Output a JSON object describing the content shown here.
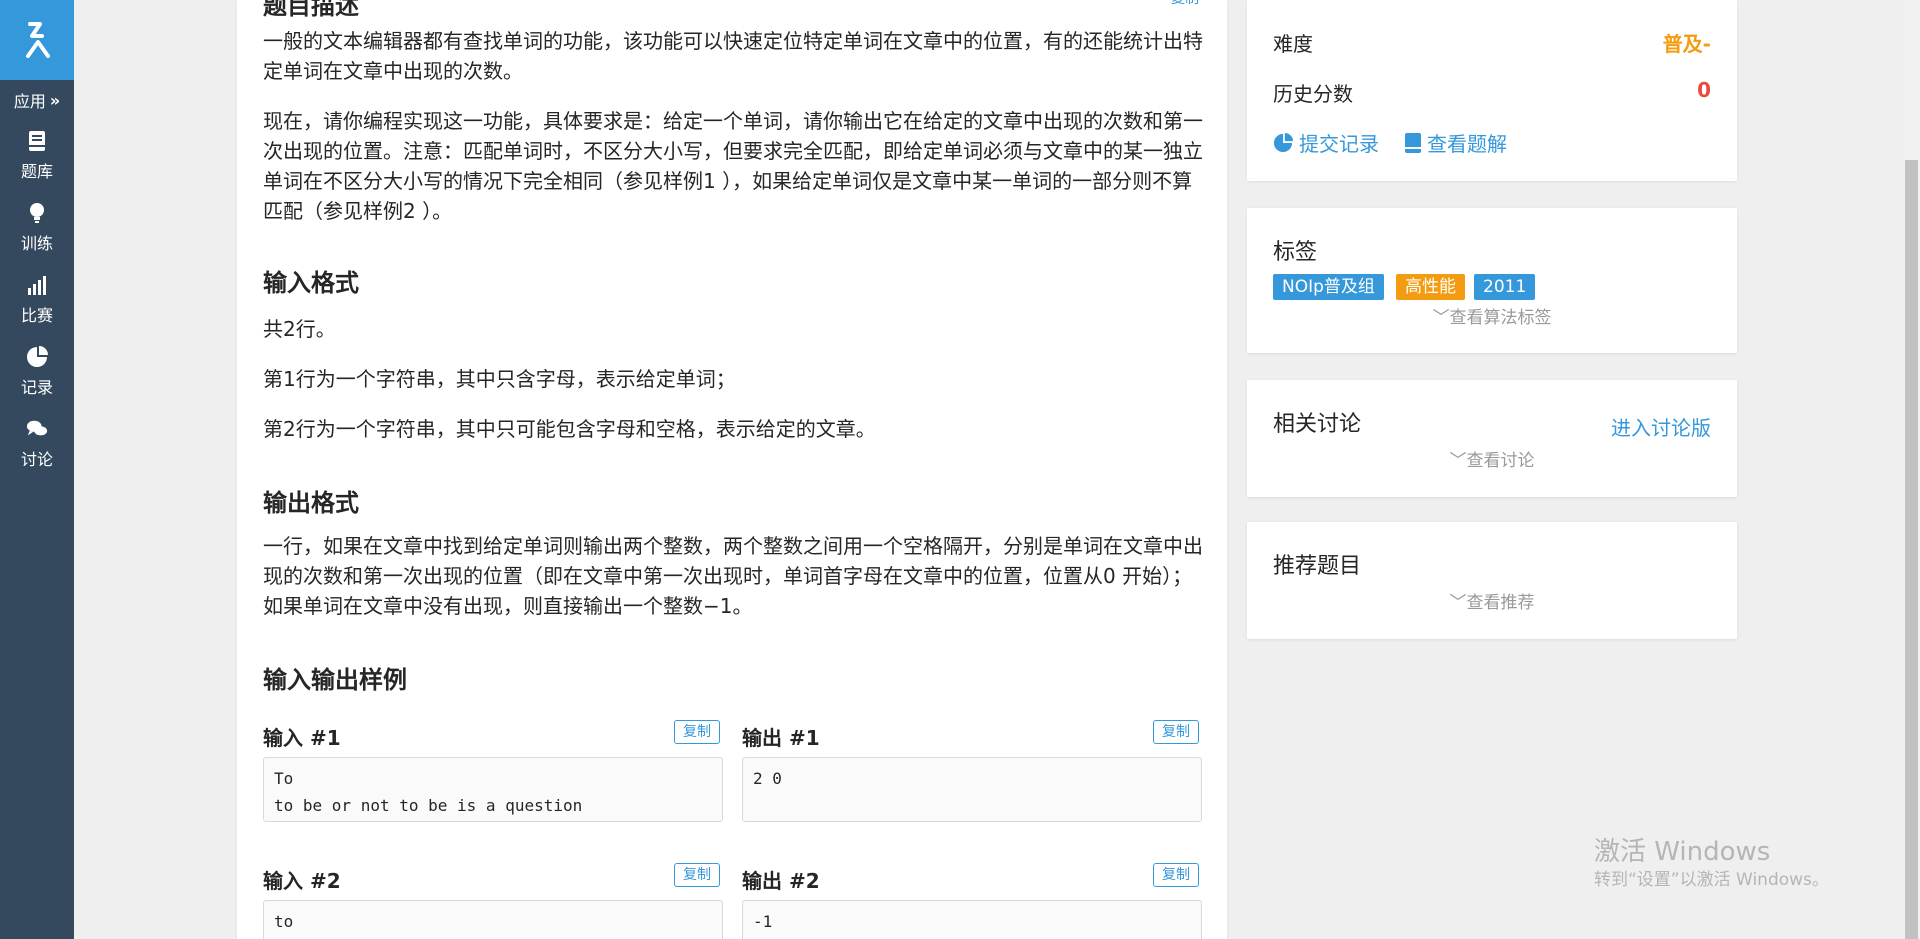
{
  "sidebar": {
    "apps_label": "应用",
    "items": [
      {
        "label": "题库",
        "icon": "book-icon"
      },
      {
        "label": "训练",
        "icon": "lightbulb-icon"
      },
      {
        "label": "比赛",
        "icon": "bar-chart-icon"
      },
      {
        "label": "记录",
        "icon": "pie-chart-icon"
      },
      {
        "label": "讨论",
        "icon": "chat-bubbles-icon"
      }
    ]
  },
  "problem": {
    "description_title": "题目描述",
    "copy_label_top": "复制",
    "description_p1": "一般的文本编辑器都有查找单词的功能，该功能可以快速定位特定单词在文章中的位置，有的还能统计出特定单词在文章中出现的次数。",
    "description_p2": "现在，请你编程实现这一功能，具体要求是：给定一个单词，请你输出它在给定的文章中出现的次数和第一次出现的位置。注意：匹配单词时，不区分大小写，但要求完全匹配，即给定单词必须与文章中的某一独立单词在不区分大小写的情况下完全相同（参见样例1 ），如果给定单词仅是文章中某一单词的一部分则不算匹配（参见样例2 ）。",
    "input_format_title": "输入格式",
    "input_line1": "共2行。",
    "input_line2": "第1行为一个字符串，其中只含字母，表示给定单词；",
    "input_line3": "第2行为一个字符串，其中只可能包含字母和空格，表示给定的文章。",
    "output_format_title": "输出格式",
    "output_text": "一行，如果在文章中找到给定单词则输出两个整数，两个整数之间用一个空格隔开，分别是单词在文章中出现的次数和第一次出现的位置（即在文章中第一次出现时，单词首字母在文章中的位置，位置从0 开始）；如果单词在文章中没有出现，则直接输出一个整数−1。",
    "samples_title": "输入输出样例",
    "copy_label": "复制",
    "samples": [
      {
        "input_label": "输入 #1",
        "output_label": "输出 #1",
        "input": "To\nto be or not to be is a question",
        "output": "2 0"
      },
      {
        "input_label": "输入 #2",
        "output_label": "输出 #2",
        "input": "to\nDid the Ottoman Empire lose its power at that time",
        "output": "-1"
      }
    ]
  },
  "info_card": {
    "difficulty_label": "难度",
    "difficulty_value": "普及-",
    "history_label": "历史分数",
    "history_value": "0",
    "submit_records": "提交记录",
    "view_solutions": "查看题解"
  },
  "tags_card": {
    "title": "标签",
    "tags": [
      {
        "label": "NOIp普及组",
        "color": "#3498db"
      },
      {
        "label": "高性能",
        "color": "#f39c11"
      },
      {
        "label": "2011",
        "color": "#3498db"
      }
    ],
    "view_algo_tags": "查看算法标签"
  },
  "discussion_card": {
    "title": "相关讨论",
    "enter_forum": "进入讨论版",
    "view_discussion": "查看讨论"
  },
  "recommend_card": {
    "title": "推荐题目",
    "view_recommend": "查看推荐"
  },
  "watermark": {
    "line1": "激活 Windows",
    "line2": "转到“设置”以激活 Windows。"
  },
  "colors": {
    "sidebar_bg": "#34495e",
    "logo_bg": "#3498db",
    "accent": "#3498db",
    "difficulty": "#f39c11",
    "score": "#e74c3c"
  }
}
